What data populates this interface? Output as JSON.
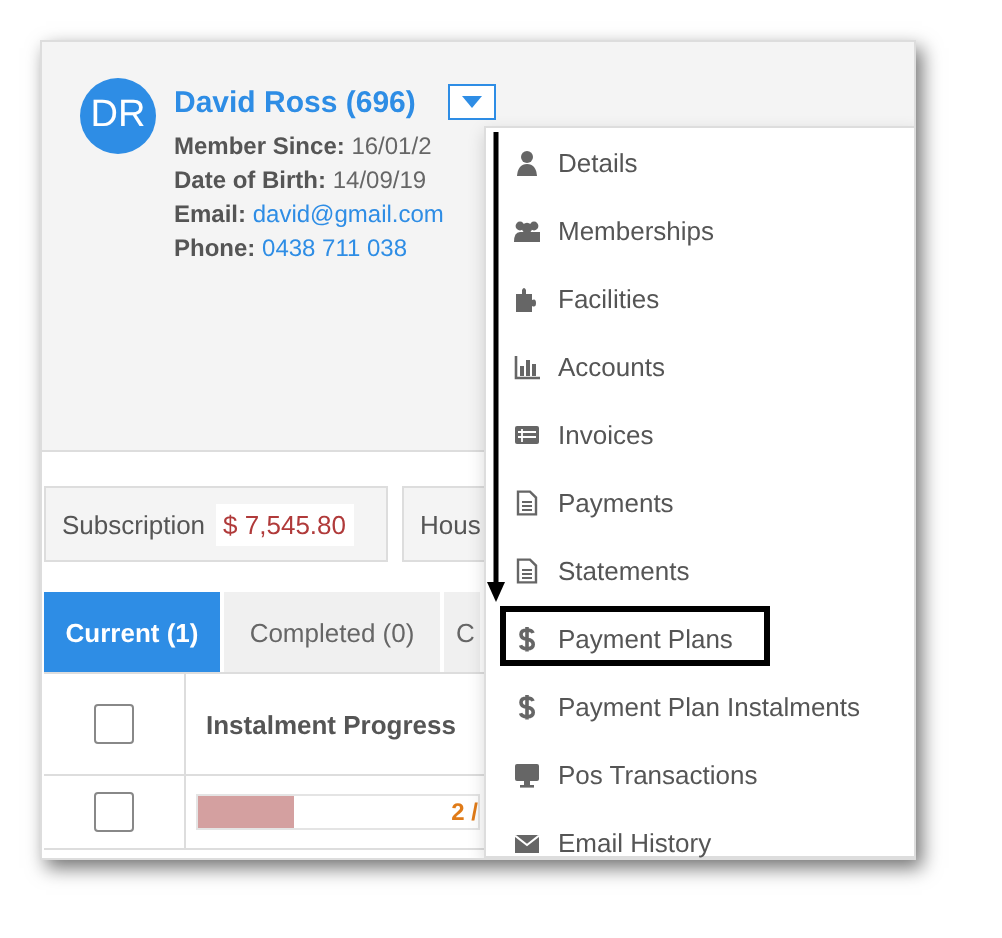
{
  "member": {
    "initials": "DR",
    "name": "David Ross (696)",
    "details": [
      {
        "label": "Member Since:",
        "value": "16/01/2",
        "kind": "text"
      },
      {
        "label": "Date of Birth:",
        "value": "14/09/19",
        "kind": "text"
      },
      {
        "label": "Email:",
        "value": "david@gmail.com",
        "kind": "link"
      },
      {
        "label": "Phone:",
        "value": "0438 711 038",
        "kind": "link"
      }
    ]
  },
  "summary": [
    {
      "label": "Subscription",
      "value": "$ 7,545.80"
    },
    {
      "label": "Hous"
    }
  ],
  "tabs": [
    {
      "label": "Current (1)",
      "selected": true
    },
    {
      "label": "Completed (0)",
      "selected": false
    },
    {
      "label": "C",
      "selected": false
    }
  ],
  "table": {
    "header_checked": false,
    "columns": [
      "Instalment Progress"
    ],
    "rows": [
      {
        "checked": false,
        "level": 0.34,
        "progress": "2 /"
      }
    ]
  },
  "menu": {
    "items": [
      {
        "label": "Details",
        "highlighted": false
      },
      {
        "label": "Memberships",
        "highlighted": false
      },
      {
        "label": "Facilities",
        "highlighted": false
      },
      {
        "label": "Accounts",
        "highlighted": false
      },
      {
        "label": "Invoices",
        "highlighted": false
      },
      {
        "label": "Payments",
        "highlighted": false
      },
      {
        "label": "Statements",
        "highlighted": false
      },
      {
        "label": "Payment Plans",
        "highlighted": true
      },
      {
        "label": "Payment Plan Instalments",
        "highlighted": false
      },
      {
        "label": "Pos Transactions",
        "highlighted": false
      },
      {
        "label": "Email History",
        "highlighted": false
      }
    ]
  }
}
